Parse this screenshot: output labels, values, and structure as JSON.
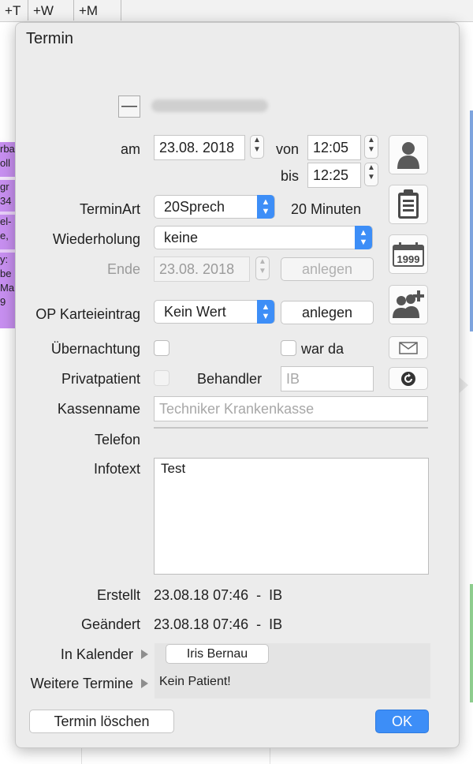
{
  "background": {
    "tabs": [
      "T",
      "+W",
      "+M"
    ],
    "event_fragments": [
      "rba",
      "oll",
      "gr",
      "34",
      "el-",
      "e,",
      "y:",
      "be",
      "Ma",
      "9"
    ]
  },
  "dialog": {
    "title": "Termin",
    "patient_toggle": "—",
    "labels": {
      "date": "am",
      "from": "von",
      "to": "bis",
      "appointment_type": "TerminArt",
      "recurrence": "Wiederholung",
      "end": "Ende",
      "op_record": "OP Karteieintrag",
      "overnight": "Übernachtung",
      "private_patient": "Privatpatient",
      "practitioner": "Behandler",
      "insurance": "Kassenname",
      "phone": "Telefon",
      "info": "Infotext",
      "created": "Erstellt",
      "changed": "Geändert",
      "in_calendar": "In Kalender",
      "other_appointments": "Weitere Termine"
    },
    "date_value": "23.08. 2018",
    "from_value": "12:05",
    "to_value": "12:25",
    "appointment_type_value": "20Sprech",
    "duration": "20 Minuten",
    "recurrence_value": "keine",
    "end_value": "23.08. 2018",
    "end_create_button": "anlegen",
    "op_record_value": "Kein Wert",
    "op_create_button": "anlegen",
    "was_there": "war da",
    "practitioner_placeholder": "IB",
    "insurance_placeholder": "Techniker Krankenkasse",
    "info_text": "Test",
    "created_value": "23.08.18 07:46  -  IB",
    "changed_value": "23.08.18 07:46  -  IB",
    "calendar_button": "Iris Bernau",
    "other_appointments_value": "Kein Patient!",
    "delete_button": "Termin löschen",
    "ok_button": "OK"
  },
  "icons": [
    "person-icon",
    "clipboard-icon",
    "calendar-icon",
    "add-person-icon",
    "mail-icon",
    "refresh-icon"
  ]
}
